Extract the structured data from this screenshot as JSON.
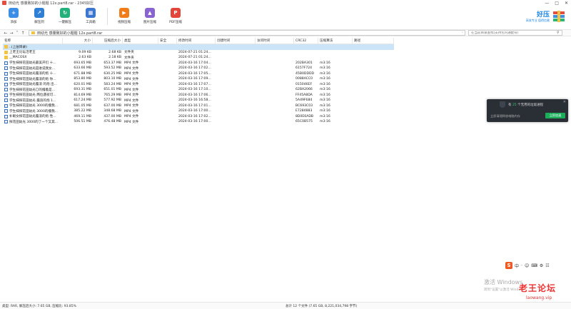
{
  "window": {
    "title": "田幼光 感量致好的小题题 12x.part8.rar - 2345好压",
    "controls": [
      "—",
      "□",
      "✕"
    ]
  },
  "toolbar": {
    "buttons": [
      {
        "label": "添加",
        "icon": "add-icon",
        "color": "#3a8ee6"
      },
      {
        "label": "解压到",
        "icon": "extract-icon",
        "color": "#2f7fd6"
      },
      {
        "label": "一键解压",
        "icon": "oneclick-extract-icon",
        "color": "#23b07a"
      },
      {
        "label": "工具箱",
        "icon": "toolbox-icon",
        "color": "#3b76d1"
      },
      {
        "label": "视频压缩",
        "icon": "video-compress-icon",
        "color": "#f07c1a"
      },
      {
        "label": "图片压缩",
        "icon": "image-compress-icon",
        "color": "#8a63d2"
      },
      {
        "label": "PDF压缩",
        "icon": "pdf-compress-icon",
        "color": "#e2463a"
      }
    ]
  },
  "brand": {
    "name": "好压",
    "slogan": "高效专业 值得信赖"
  },
  "address": {
    "path": "田幼光 感量致好的小题题 12x.part8.rar",
    "search_placeholder": "在当前目录查找(支持包内通配符)"
  },
  "columns": [
    "名称",
    "大小",
    "压缩后大小",
    "类型",
    "安全",
    "修改时间",
    "创建时间",
    "访问时间",
    "CRC32",
    "压缩算法",
    "路径"
  ],
  "files": [
    {
      "name": "..(上层目录)",
      "size": "",
      "packed": "",
      "type": "",
      "modified": "",
      "crc": "",
      "method": "",
      "kind": "up"
    },
    {
      "name": "上老王论坛活老王",
      "size": "9.09 KB",
      "packed": "2.68 KB",
      "type": "文件夹",
      "modified": "2024-07-21 01:24...",
      "crc": "",
      "method": "",
      "kind": "folder"
    },
    {
      "name": "__MACOSX",
      "size": "2.63 KB",
      "packed": "2.18 KB",
      "type": "文件夹",
      "modified": "2024-07-21 01:24...",
      "crc": "",
      "method": "",
      "kind": "folder"
    },
    {
      "name": "学生抹探花田幼光最美开们 十...",
      "size": "693.65 MB",
      "packed": "653.37 MB",
      "type": "MP4 文件",
      "modified": "2024-03-16 17:04...",
      "crc": "202BA301",
      "method": "m3:16",
      "kind": "video"
    },
    {
      "name": "学生抹探花田幼光田进说我女...",
      "size": "633.66 MB",
      "packed": "593.52 MB",
      "type": "MP4 文件",
      "modified": "2024-03-16 17:02...",
      "crc": "6157F724",
      "method": "m3:16",
      "kind": "video"
    },
    {
      "name": "学生抹探花田幼光露浪的炮 十...",
      "size": "671.88 MB",
      "packed": "630.25 MB",
      "type": "MP4 文件",
      "modified": "2024-03-16 17:05...",
      "crc": "45B0DDDD",
      "method": "m3:16",
      "kind": "video"
    },
    {
      "name": "学生抹探花田幼光露浪的炮 你...",
      "size": "853.80 MB",
      "packed": "803.10 MB",
      "type": "MP4 文件",
      "modified": "2024-03-16 17:09...",
      "crc": "0088ACC0",
      "method": "m3:16",
      "kind": "video"
    },
    {
      "name": "学生抹探花田幼光露浪 的炮 出...",
      "size": "620.01 MB",
      "packed": "583.24 MB",
      "type": "MP4 文件",
      "modified": "2024-03-16 17:07...",
      "crc": "015046EF",
      "method": "m3:16",
      "kind": "video"
    },
    {
      "name": "学生抹探花田幼光〇的撸着是...",
      "size": "693.31 MB",
      "packed": "651.01 MB",
      "type": "MP4 文件",
      "modified": "2024-03-16 17:10...",
      "crc": "62BA2066",
      "method": "m3:16",
      "kind": "video"
    },
    {
      "name": "学生抹探花田幼光 两位遇祯可...",
      "size": "814.69 MB",
      "packed": "765.29 MB",
      "type": "MP4 文件",
      "modified": "2024-03-16 17:06...",
      "crc": "FF45A8DA",
      "method": "m3:16",
      "kind": "video"
    },
    {
      "name": "学生抹探花田幼光 露浪的炮 1...",
      "size": "617.24 MB",
      "packed": "577.92 MB",
      "type": "MP4 文件",
      "modified": "2024-03-16 16:58...",
      "crc": "5A49F684",
      "method": "m3:16",
      "kind": "video"
    },
    {
      "name": "学生抹探花田幼光 3000的撸我...",
      "size": "681.05 MB",
      "packed": "637.00 MB",
      "type": "MP4 文件",
      "modified": "2024-03-16 17:01...",
      "crc": "BC693C03",
      "method": "m3:16",
      "kind": "video"
    },
    {
      "name": "学生抹探花田幼光 3000的撸我...",
      "size": "385.22 MB",
      "packed": "348.68 MB",
      "type": "MP4 文件",
      "modified": "2024-03-16 17:00...",
      "crc": "E7284883",
      "method": "m3:16",
      "kind": "video"
    },
    {
      "name": "补眼女探花田幼光露浪的炮 性...",
      "size": "469.11 MB",
      "packed": "437.00 MB",
      "type": "MP4 文件",
      "modified": "2024-03-16 17:02...",
      "crc": "8D0E6ADB",
      "method": "m3:16",
      "kind": "video"
    },
    {
      "name": "探花田幼光 3000的了一个又其...",
      "size": "506.51 MB",
      "packed": "476.48 MB",
      "type": "MP4 文件",
      "modified": "2024-03-16 17:00...",
      "crc": "65C0B575",
      "method": "m3:16",
      "kind": "video"
    }
  ],
  "popup": {
    "prefix": "有",
    "count": "25",
    "suffix": "个无用的垃圾进程",
    "message": "立即清理释放电脑内存",
    "button": "立即加速",
    "close": "✕"
  },
  "ime": {
    "logo": "S",
    "symbols": [
      "中",
      "·",
      "☺",
      "⌨",
      "⚙",
      "☷"
    ]
  },
  "activation": {
    "line1": "激活 Windows",
    "line2": "转到\"设置\"以激活 Windows。"
  },
  "watermark": {
    "line1": "老王论坛",
    "line2": "laowang.vip"
  },
  "status": {
    "left": "类型: RAR, 解压后大小: 7.65 GB, 压缩比: 93.85%",
    "right": "总计 12 个文件 (7.65 GB, 8,221,034,798 字节)"
  }
}
